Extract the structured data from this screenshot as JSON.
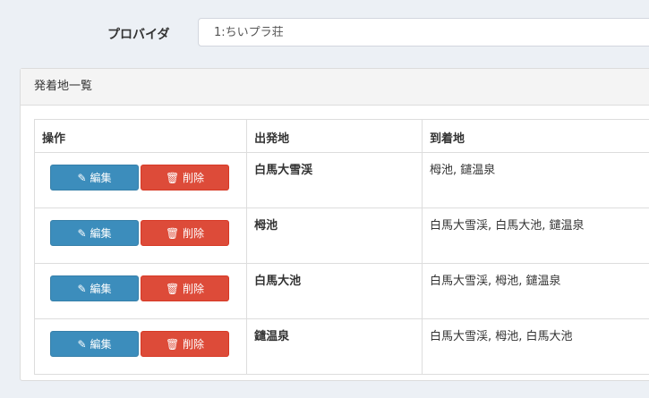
{
  "provider": {
    "label": "プロバイダ",
    "value": "1:ちいプラ荘"
  },
  "panel": {
    "title": "発着地一覧"
  },
  "table": {
    "headers": [
      "操作",
      "出発地",
      "到着地"
    ],
    "edit_label": "編集",
    "delete_label": "削除",
    "rows": [
      {
        "departure": "白馬大雪渓",
        "arrivals": "栂池, 鑓温泉"
      },
      {
        "departure": "栂池",
        "arrivals": "白馬大雪渓, 白馬大池, 鑓温泉"
      },
      {
        "departure": "白馬大池",
        "arrivals": "白馬大雪渓, 栂池, 鑓温泉"
      },
      {
        "departure": "鑓温泉",
        "arrivals": "白馬大雪渓, 栂池, 白馬大池"
      }
    ]
  }
}
